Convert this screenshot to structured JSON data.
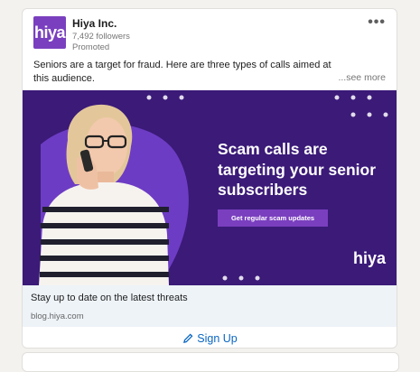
{
  "post": {
    "company": "Hiya Inc.",
    "logo_text": "hiya",
    "followers": "7,492 followers",
    "promoted": "Promoted",
    "text": "Seniors are a target for fraud. Here are three types of calls aimed at this audience.",
    "see_more": "...see more",
    "menu_icon": "more-horizontal-icon"
  },
  "ad": {
    "headline": "Scam calls are targeting your senior subscribers",
    "cta": "Get regular scam updates",
    "brand": "hiya",
    "colors": {
      "background": "#3b1a78",
      "accent": "#7a3fbf"
    }
  },
  "link": {
    "title": "Stay up to date on the latest threats",
    "url": "blog.hiya.com"
  },
  "action": {
    "icon": "pencil-icon",
    "label": "Sign Up",
    "color": "#0a66c2"
  }
}
